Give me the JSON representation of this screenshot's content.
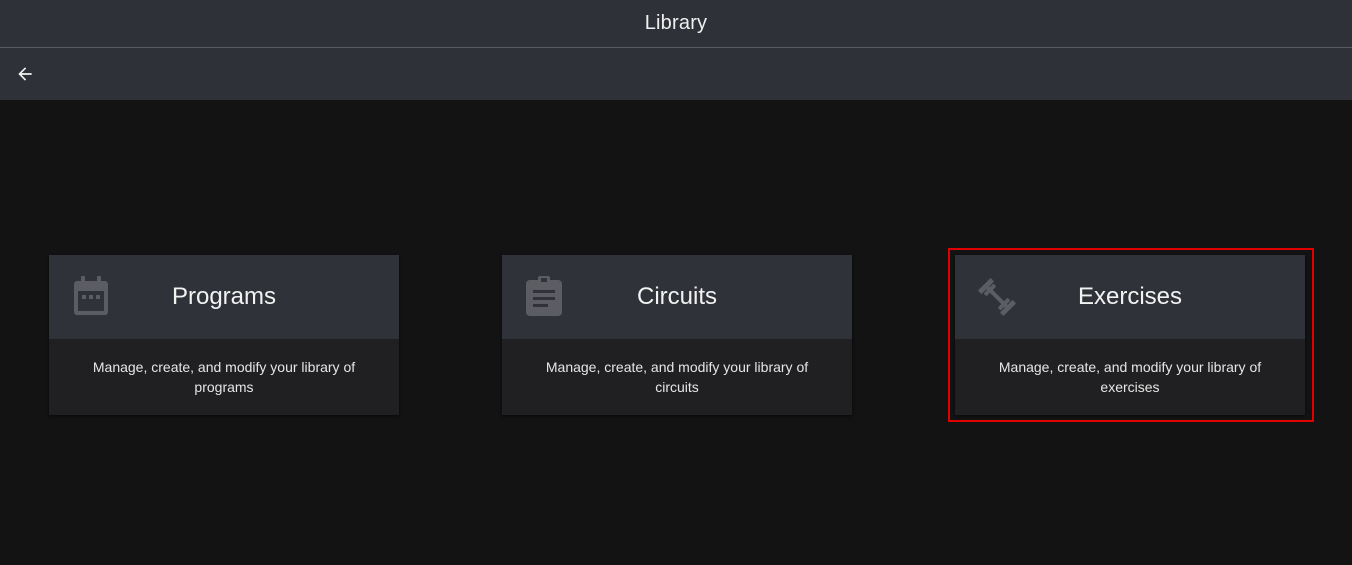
{
  "header": {
    "title": "Library"
  },
  "toolbar": {
    "back_icon": "arrow-back-icon"
  },
  "cards": [
    {
      "title": "Programs",
      "description": "Manage, create, and modify your library of programs",
      "icon": "calendar-icon"
    },
    {
      "title": "Circuits",
      "description": "Manage, create, and modify your library of circuits",
      "icon": "clipboard-icon"
    },
    {
      "title": "Exercises",
      "description": "Manage, create, and modify your library of exercises",
      "icon": "dumbbell-icon"
    }
  ],
  "colors": {
    "background": "#131314",
    "header_bg": "#2f3138",
    "card_header_bg": "#30323a",
    "card_body_bg": "#202022",
    "icon_color": "#5c5d63",
    "highlight": "#e00000"
  }
}
